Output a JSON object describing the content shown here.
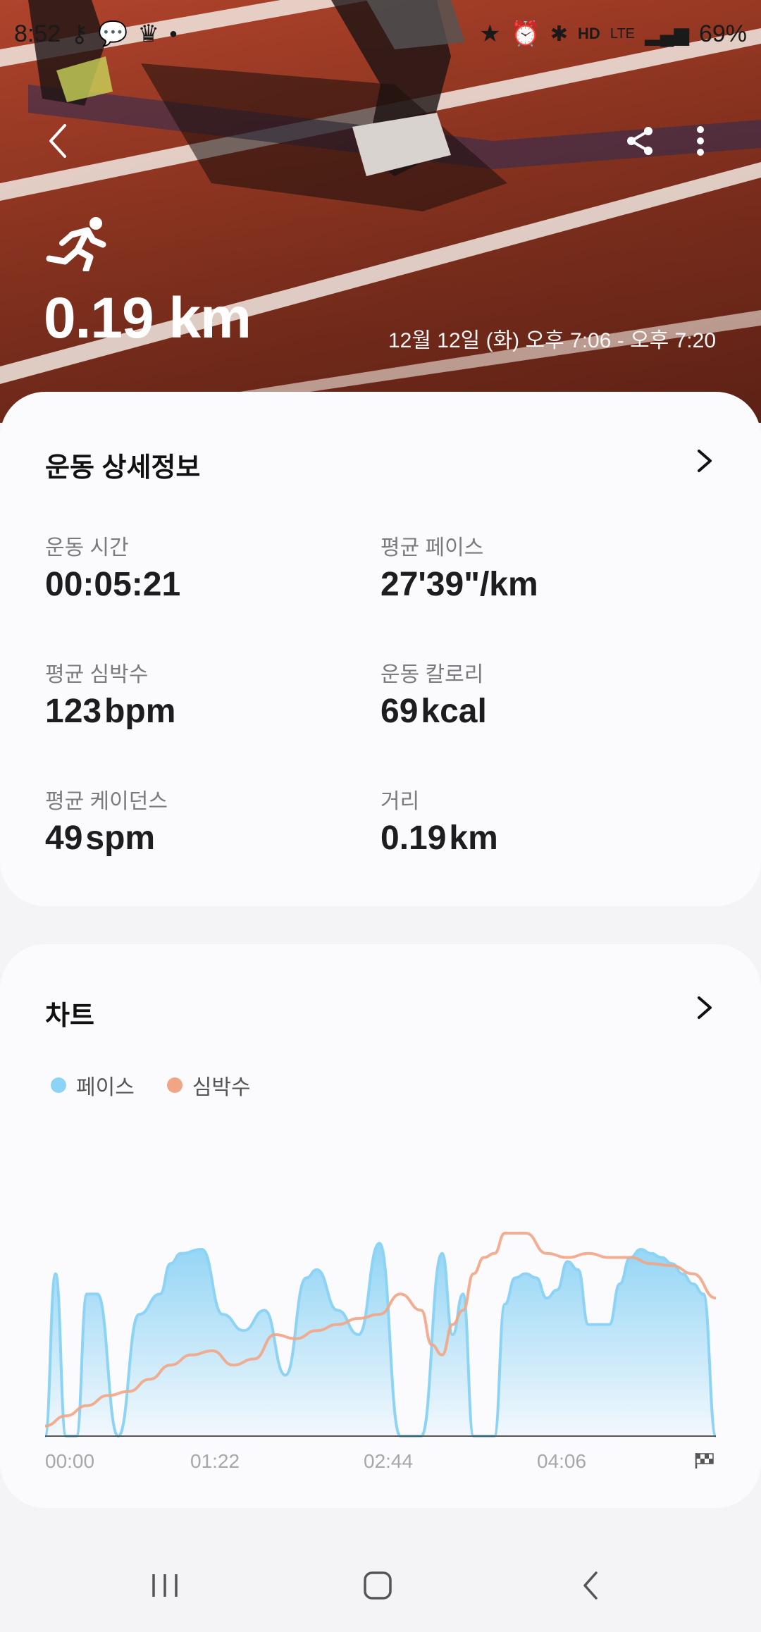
{
  "status_bar": {
    "time": "8:52",
    "battery": "69%",
    "network": "LTE",
    "hd_label": "HD",
    "left_icons": [
      "key-icon",
      "chat-icon",
      "crown-icon",
      "dot-icon"
    ],
    "right_icons": [
      "star-icon",
      "alarm-icon",
      "bluetooth-icon",
      "hd-voice-icon",
      "lte-icon",
      "signal-icon",
      "battery-icon"
    ]
  },
  "header": {
    "distance": "0.19 km",
    "date_range": "12월 12일 (화) 오후 7:06 - 오후 7:20",
    "activity_icon": "running-icon"
  },
  "details": {
    "title": "운동 상세정보",
    "stats": [
      {
        "label": "운동 시간",
        "value": "00:05:21",
        "unit": ""
      },
      {
        "label": "평균 페이스",
        "value": "27'39\"/km",
        "unit": ""
      },
      {
        "label": "평균 심박수",
        "value": "123",
        "unit": "bpm"
      },
      {
        "label": "운동 칼로리",
        "value": "69",
        "unit": "kcal"
      },
      {
        "label": "평균 케이던스",
        "value": "49",
        "unit": "spm"
      },
      {
        "label": "거리",
        "value": "0.19",
        "unit": "km"
      }
    ]
  },
  "chart_card": {
    "title": "차트",
    "legend": [
      {
        "label": "페이스",
        "color": "#8dd3f5"
      },
      {
        "label": "심박수",
        "color": "#f2a585"
      }
    ]
  },
  "chart_data": {
    "type": "area",
    "x_ticks": [
      "00:00",
      "01:22",
      "02:44",
      "04:06"
    ],
    "end_marker": "finish-flag-icon",
    "x_range": [
      0,
      321
    ],
    "series": [
      {
        "name": "페이스",
        "color": "#8dd3f5",
        "x": [
          0,
          5,
          10,
          15,
          20,
          25,
          35,
          45,
          55,
          60,
          65,
          75,
          85,
          95,
          105,
          115,
          125,
          130,
          140,
          150,
          160,
          170,
          180,
          190,
          195,
          200,
          205,
          210,
          215,
          220,
          225,
          230,
          235,
          240,
          245,
          250,
          255,
          260,
          265,
          270,
          275,
          280,
          285,
          290,
          295,
          300,
          305,
          310,
          315,
          321
        ],
        "y": [
          0,
          80,
          0,
          0,
          70,
          70,
          0,
          60,
          70,
          85,
          90,
          92,
          60,
          52,
          62,
          30,
          78,
          82,
          62,
          50,
          95,
          0,
          0,
          90,
          50,
          70,
          0,
          0,
          0,
          65,
          78,
          80,
          78,
          68,
          72,
          86,
          82,
          55,
          55,
          55,
          75,
          88,
          92,
          90,
          88,
          85,
          80,
          75,
          70,
          0
        ]
      },
      {
        "name": "심박수",
        "color": "#f2a585",
        "x": [
          0,
          10,
          20,
          30,
          40,
          50,
          60,
          70,
          80,
          90,
          100,
          110,
          120,
          130,
          140,
          150,
          160,
          170,
          180,
          185,
          190,
          195,
          200,
          205,
          210,
          215,
          220,
          225,
          230,
          240,
          250,
          260,
          270,
          280,
          290,
          300,
          310,
          321
        ],
        "y": [
          5,
          10,
          15,
          20,
          22,
          28,
          35,
          40,
          42,
          35,
          38,
          50,
          48,
          52,
          55,
          58,
          60,
          70,
          62,
          45,
          40,
          55,
          62,
          80,
          88,
          90,
          100,
          100,
          100,
          90,
          88,
          90,
          88,
          88,
          85,
          84,
          80,
          68
        ]
      }
    ]
  },
  "navbar": {
    "items": [
      "recent-apps-icon",
      "home-icon",
      "back-icon"
    ]
  }
}
